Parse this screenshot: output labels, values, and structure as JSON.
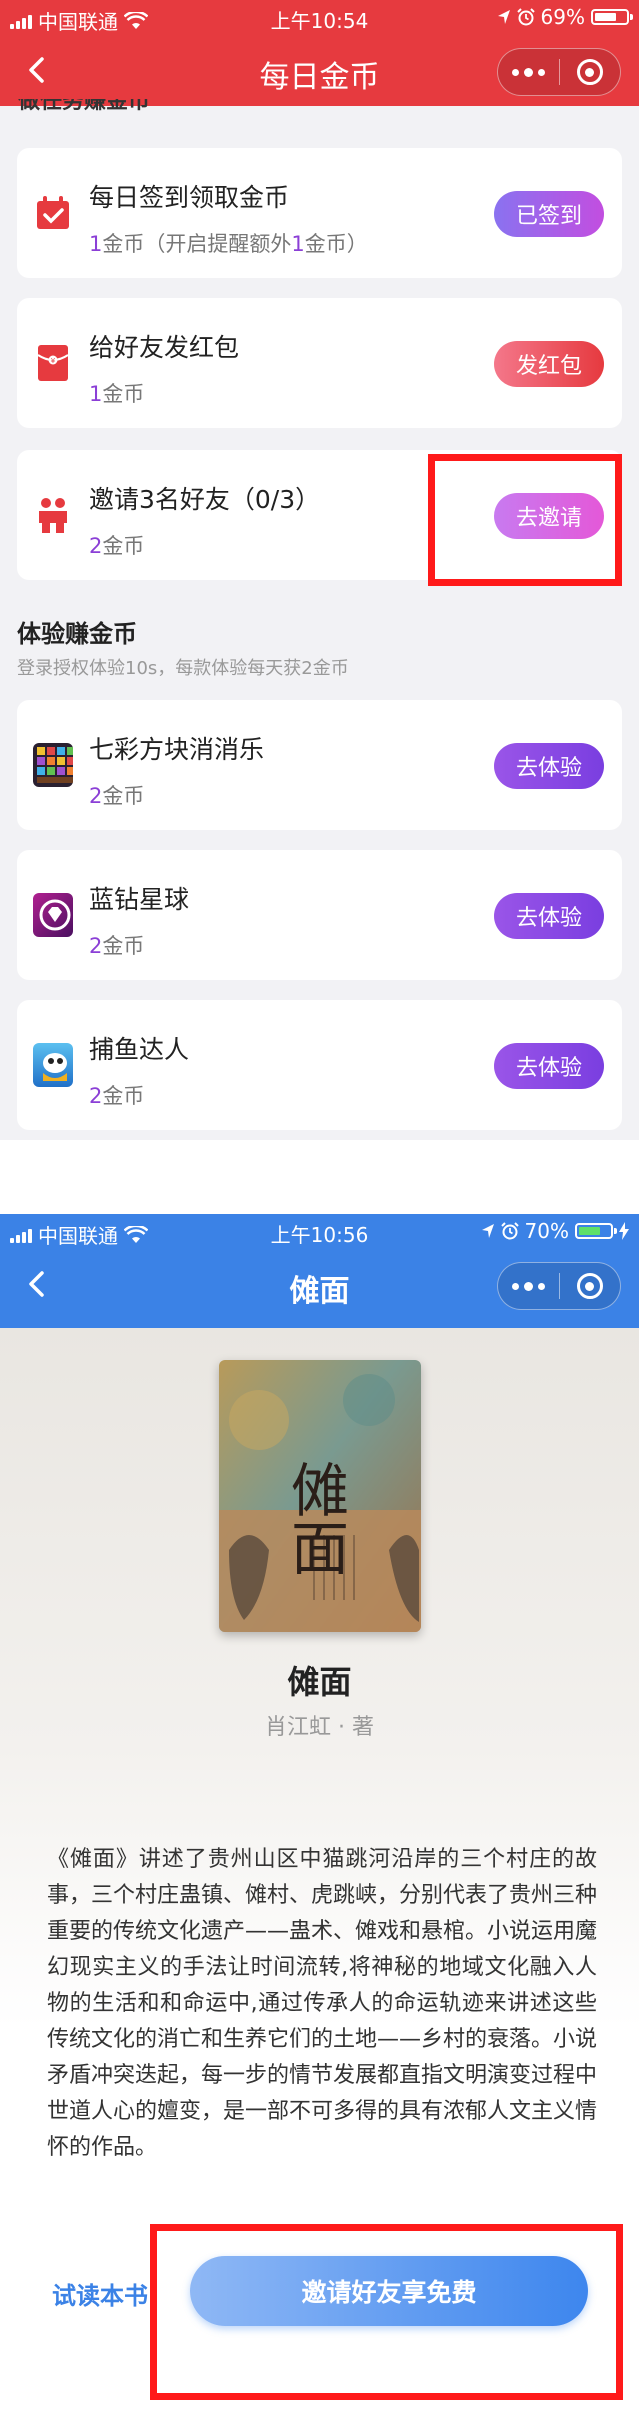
{
  "screen1": {
    "status_bar": {
      "carrier": "中国联通",
      "time": "上午10:54",
      "battery": "69%",
      "battery_level": 0.69
    },
    "nav": {
      "title": "每日金币"
    },
    "section_cut_title": "做任务赚金币",
    "tasks": [
      {
        "name": "每日签到领取金币",
        "reward_num": "1",
        "reward_text": "金币（开启提醒额外",
        "reward_num2": "1",
        "reward_tail": "金币）",
        "button": "已签到",
        "icon": "calendar-icon"
      },
      {
        "name": "给好友发红包",
        "reward_num": "1",
        "reward_text": "金币",
        "button": "发红包",
        "icon": "red-envelope-icon"
      },
      {
        "name": "邀请3名好友（0/3）",
        "reward_num": "2",
        "reward_text": "金币",
        "button": "去邀请",
        "icon": "friends-icon"
      }
    ],
    "experience": {
      "title": "体验赚金币",
      "subtitle": "登录授权体验10s，每款体验每天获2金币",
      "apps": [
        {
          "name": "七彩方块消消乐",
          "reward_num": "2",
          "reward_text": "金币",
          "button": "去体验",
          "icon": "block-game-icon"
        },
        {
          "name": "蓝钻星球",
          "reward_num": "2",
          "reward_text": "金币",
          "button": "去体验",
          "icon": "diamond-planet-icon"
        },
        {
          "name": "捕鱼达人",
          "reward_num": "2",
          "reward_text": "金币",
          "button": "去体验",
          "icon": "fishing-game-icon"
        }
      ]
    },
    "colors": {
      "header": "#e63a3f",
      "reward_num": "#8b3fd6"
    }
  },
  "screen2": {
    "status_bar": {
      "carrier": "中国联通",
      "time": "上午10:56",
      "battery": "70%",
      "battery_level": 0.7
    },
    "nav": {
      "title": "傩面"
    },
    "book": {
      "title": "傩面",
      "author": "肖江虹 · 著",
      "description": "《傩面》讲述了贵州山区中猫跳河沿岸的三个村庄的故事，三个村庄蛊镇、傩村、虎跳峡，分别代表了贵州三种重要的传统文化遗产——蛊术、傩戏和悬棺。小说运用魔幻现实主义的手法让时间流转,将神秘的地域文化融入人物的生活和和命运中,通过传承人的命运轨迹来讲述这些传统文化的消亡和生养它们的土地——乡村的衰落。小说矛盾冲突迭起，每一步的情节发展都直指文明演变过程中世道人心的嬗变，是一部不可多得的具有浓郁人文主义情怀的作品。",
      "cover_title": "傩面"
    },
    "actions": {
      "trial": "试读本书",
      "invite": "邀请好友享免费"
    },
    "colors": {
      "header": "#3b82e6",
      "link": "#3b82e6"
    }
  }
}
